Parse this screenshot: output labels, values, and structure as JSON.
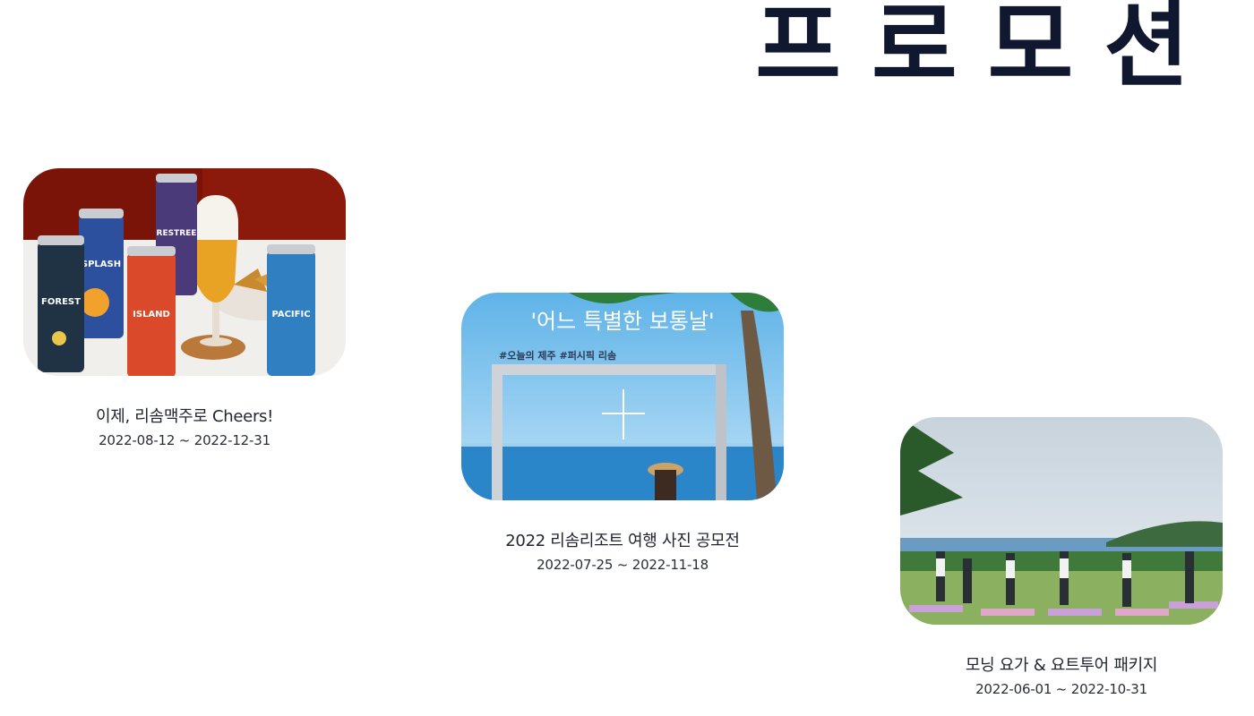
{
  "page": {
    "title": "프로모션"
  },
  "promotions": [
    {
      "title": "이제, 리솜맥주로 Cheers!",
      "date": "2022-08-12 ~ 2022-12-31",
      "image": {
        "can_labels": [
          "FOREST",
          "SPLASH",
          "ISLAND",
          "RESTREE",
          "PACIFIC"
        ]
      }
    },
    {
      "title": "2022 리솜리조트 여행 사진 공모전",
      "date": "2022-07-25 ~ 2022-11-18",
      "image": {
        "headline": "'어느 특별한 보통날'",
        "hashtags": "#오늘의 제주 #퍼시픽 리솜"
      }
    },
    {
      "title": "모닝 요가 & 요트투어 패키지",
      "date": "2022-06-01 ~ 2022-10-31"
    }
  ]
}
